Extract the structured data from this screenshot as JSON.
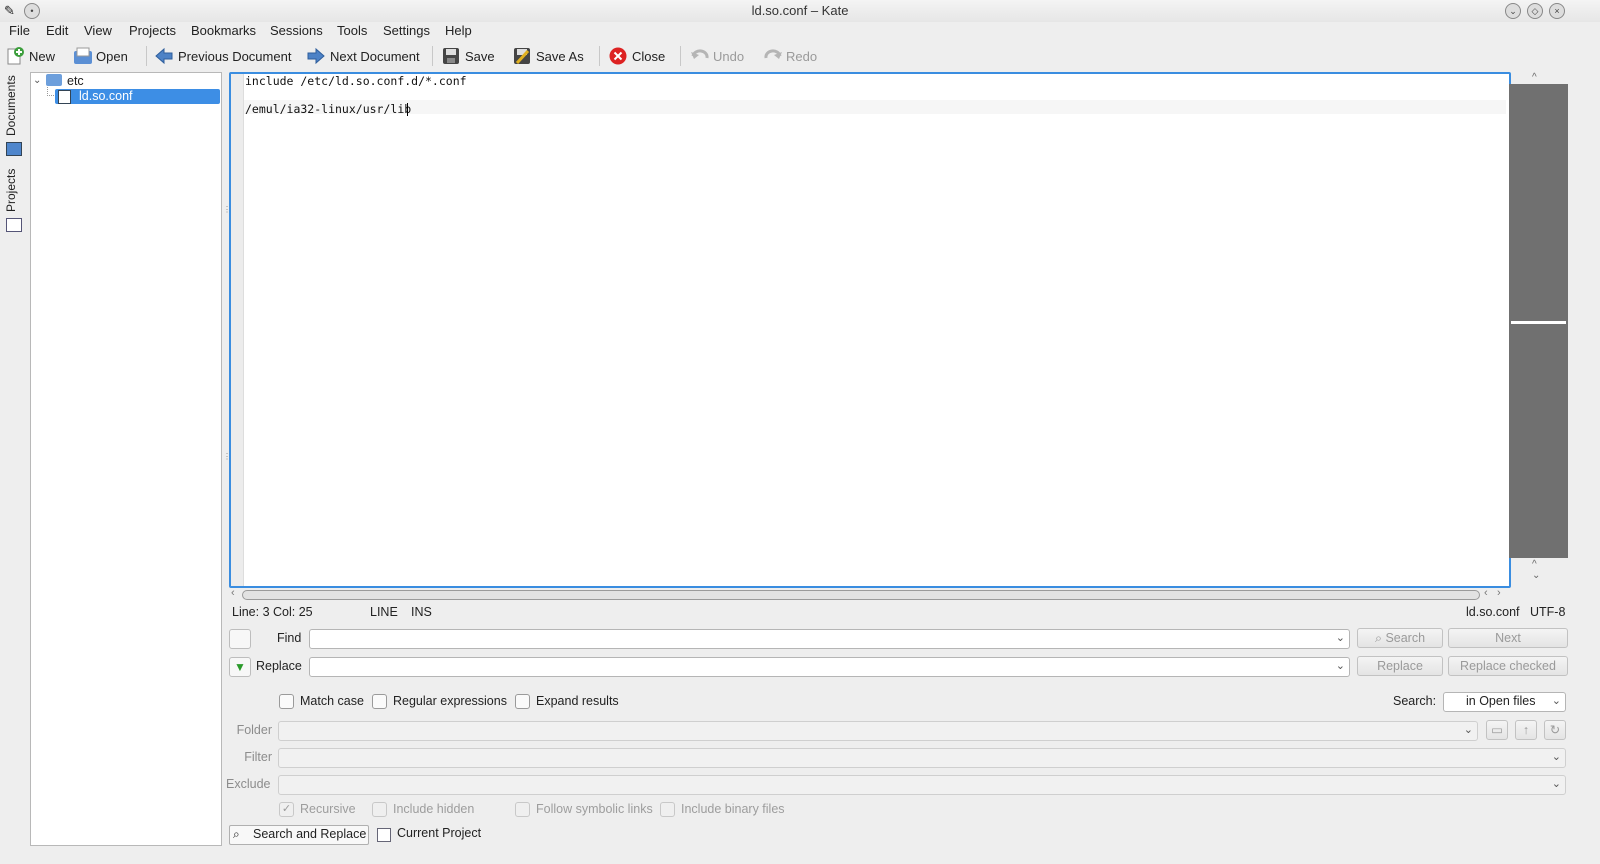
{
  "window": {
    "title": "ld.so.conf – Kate"
  },
  "menubar": [
    "File",
    "Edit",
    "View",
    "Projects",
    "Bookmarks",
    "Sessions",
    "Tools",
    "Settings",
    "Help"
  ],
  "toolbar": {
    "new": "New",
    "open": "Open",
    "previous": "Previous Document",
    "next": "Next Document",
    "save": "Save",
    "save_as": "Save As",
    "close": "Close",
    "undo": "Undo",
    "redo": "Redo"
  },
  "sidetabs": {
    "documents": "Documents",
    "projects": "Projects"
  },
  "tree": {
    "folder": "etc",
    "file": "ld.so.conf"
  },
  "editor": {
    "lines": [
      "include /etc/ld.so.conf.d/*.conf",
      "",
      "/emul/ia32-linux/usr/lib"
    ]
  },
  "status": {
    "position": "Line: 3 Col: 25",
    "mode": "LINE",
    "insert": "INS",
    "filename": "ld.so.conf",
    "encoding": "UTF-8"
  },
  "search": {
    "find_label": "Find",
    "replace_label": "Replace",
    "search_btn": "Search",
    "next_btn": "Next",
    "replace_btn": "Replace",
    "replace_checked_btn": "Replace checked",
    "match_case": "Match case",
    "regex": "Regular expressions",
    "expand": "Expand results",
    "scope_label": "Search:",
    "scope_value": "in Open files",
    "folder_label": "Folder",
    "filter_label": "Filter",
    "exclude_label": "Exclude",
    "recursive": "Recursive",
    "include_hidden": "Include hidden",
    "follow_links": "Follow symbolic links",
    "include_binary": "Include binary files"
  },
  "bottom_tabs": {
    "search_replace": "Search and Replace",
    "current_project": "Current Project"
  },
  "colors": {
    "accent": "#3a8de0",
    "selection": "#3d8ee5",
    "minimap": "#707070"
  }
}
